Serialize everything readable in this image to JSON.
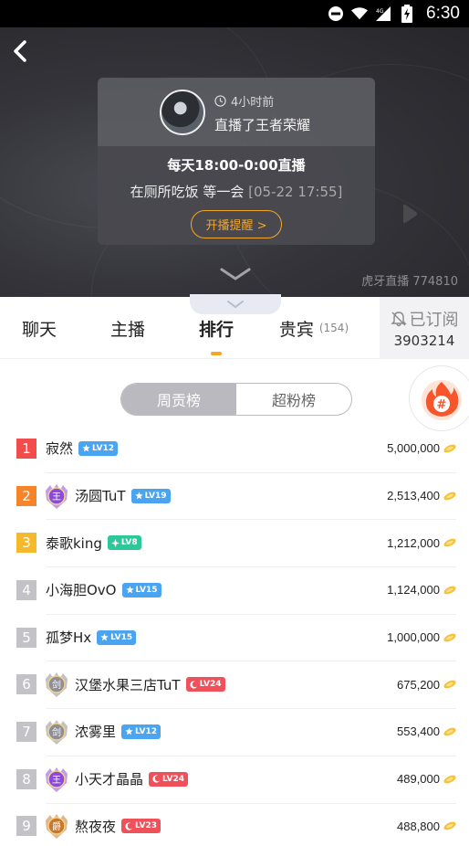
{
  "status_bar": {
    "time": "6:30",
    "network": "4G"
  },
  "live_card": {
    "time_ago": "4小时前",
    "game_line": "直播了王者荣耀",
    "schedule": "每天18:00-0:00直播",
    "desc": "在厕所吃饭 等一会 ",
    "desc_time": "[05-22 17:55]",
    "remind_label": "开播提醒 >"
  },
  "watermark": "虎牙直播 774810",
  "tabs": [
    {
      "label": "聊天"
    },
    {
      "label": "主播"
    },
    {
      "label": "排行"
    },
    {
      "label": "贵宾",
      "count": "(154)"
    }
  ],
  "subscribe": {
    "label": "已订阅",
    "count": "3903214"
  },
  "rank_switch": {
    "options": [
      "周贡榜",
      "超粉榜"
    ],
    "selected": "周贡榜"
  },
  "colors": {
    "accent": "#f5a623",
    "rank1": "#f24c4c",
    "rank2": "#f5842b",
    "rank3": "#f5b92b",
    "rank_other": "#c2c2c7",
    "lv_blue": "#4aa4f0",
    "lv_green": "#2ec79a",
    "lv_red": "#f0505a"
  },
  "ranking": [
    {
      "rank": "1",
      "name": "寂然",
      "level": "LV12",
      "level_kind": "star",
      "medal": "",
      "score": "5,000,000"
    },
    {
      "rank": "2",
      "name": "汤圆TuT",
      "level": "LV19",
      "level_kind": "star",
      "medal": "王",
      "score": "2,513,400"
    },
    {
      "rank": "3",
      "name": "泰歌king",
      "level": "LV8",
      "level_kind": "diamond",
      "medal": "",
      "score": "1,212,000"
    },
    {
      "rank": "4",
      "name": "小海胆OvO",
      "level": "LV15",
      "level_kind": "star",
      "medal": "",
      "score": "1,124,000"
    },
    {
      "rank": "5",
      "name": "孤梦Hx",
      "level": "LV15",
      "level_kind": "star",
      "medal": "",
      "score": "1,000,000"
    },
    {
      "rank": "6",
      "name": "汉堡水果三店TuT",
      "level": "LV24",
      "level_kind": "moon",
      "medal": "剑",
      "score": "675,200"
    },
    {
      "rank": "7",
      "name": "浓雾里",
      "level": "LV12",
      "level_kind": "star",
      "medal": "剑",
      "score": "553,400"
    },
    {
      "rank": "8",
      "name": "小天才晶晶",
      "level": "LV24",
      "level_kind": "moon",
      "medal": "王",
      "score": "489,000"
    },
    {
      "rank": "9",
      "name": "熬夜夜",
      "level": "LV23",
      "level_kind": "moon",
      "medal": "爵",
      "score": "488,800"
    }
  ]
}
